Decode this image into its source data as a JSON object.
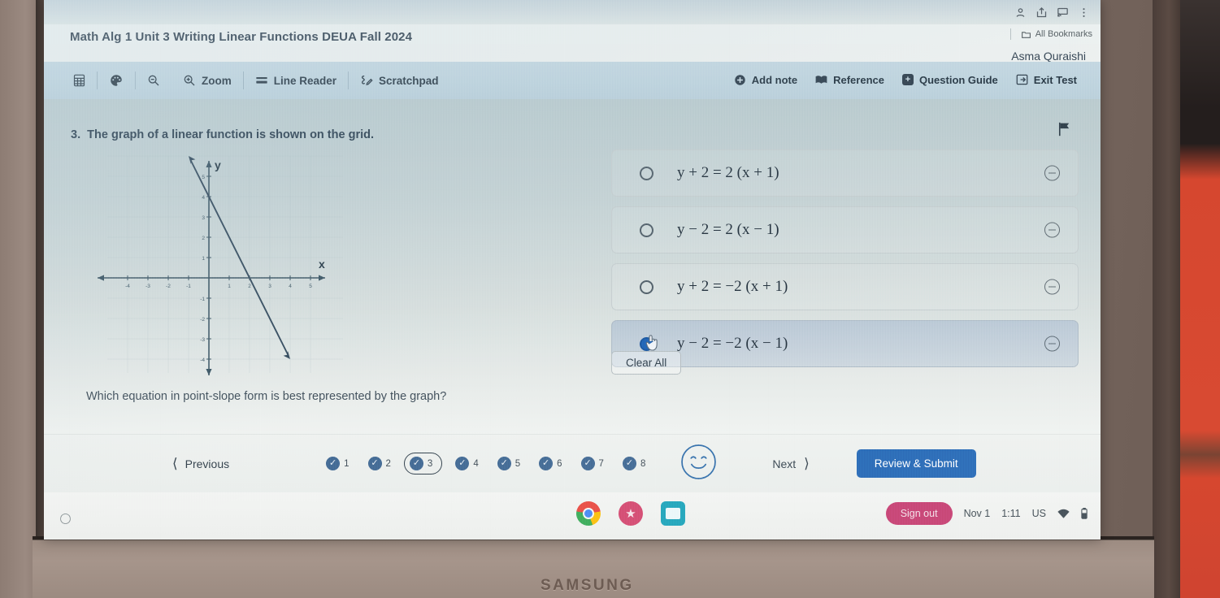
{
  "device": {
    "brand": "SAMSUNG"
  },
  "browser": {
    "all_bookmarks_label": "All Bookmarks",
    "folder_icon": "folder-icon",
    "menu_icon": "kebab-menu-icon",
    "cast_icon": "cast-icon",
    "share_icon": "share-icon",
    "profile_icon": "profile-icon"
  },
  "header": {
    "title": "Math Alg 1 Unit 3 Writing Linear Functions DEUA Fall 2024",
    "student_name": "Asma Quraishi"
  },
  "toolbar": {
    "left_tools": [
      {
        "name": "calculator",
        "icon": "calculator-icon",
        "label": ""
      },
      {
        "name": "color-palette",
        "icon": "palette-icon",
        "label": ""
      },
      {
        "name": "zoom",
        "icon": "zoom-icon",
        "label": "Zoom"
      },
      {
        "name": "line-reader",
        "icon": "line-reader-icon",
        "label": "Line Reader"
      },
      {
        "name": "scratchpad",
        "icon": "scratchpad-icon",
        "label": "Scratchpad"
      }
    ],
    "right_tools": [
      {
        "name": "add-note",
        "icon": "plus-circle-icon",
        "label": "Add note"
      },
      {
        "name": "reference",
        "icon": "book-icon",
        "label": "Reference"
      },
      {
        "name": "question-guide",
        "icon": "guide-icon",
        "label": "Question Guide"
      },
      {
        "name": "exit-test",
        "icon": "exit-icon",
        "label": "Exit Test"
      }
    ]
  },
  "question": {
    "number": "3.",
    "stem": "The graph of a linear function is shown on the grid.",
    "prompt": "Which equation in point-slope form is best represented by the graph?",
    "flag_icon": "flag-icon"
  },
  "chart_data": {
    "type": "line",
    "title": "",
    "xlabel": "x",
    "ylabel": "y",
    "xlim": [
      -5,
      5.6
    ],
    "ylim": [
      -4.8,
      6
    ],
    "xticks": [
      -4,
      -3,
      -2,
      -1,
      1,
      2,
      3,
      4,
      5
    ],
    "yticks": [
      -4,
      -3,
      -2,
      -1,
      1,
      2,
      3,
      4,
      5
    ],
    "grid": true,
    "series": [
      {
        "name": "linear function",
        "equation": "y = -2x + 4",
        "slope": -2,
        "y_intercept": 4,
        "x_intercept": 2,
        "points": [
          [
            -1,
            6
          ],
          [
            0,
            4
          ],
          [
            1,
            2
          ],
          [
            2,
            0
          ],
          [
            3,
            -2
          ],
          [
            4,
            -4
          ]
        ],
        "endpoints_arrows": true,
        "color": "#2e4558"
      }
    ]
  },
  "options": [
    {
      "id": "A",
      "equation": "y + 2 = 2 (x + 1)",
      "selected": false,
      "eliminate_icon": "minus-circle-icon"
    },
    {
      "id": "B",
      "equation": "y − 2 = 2 (x − 1)",
      "selected": false,
      "eliminate_icon": "minus-circle-icon"
    },
    {
      "id": "C",
      "equation": "y + 2 = −2 (x + 1)",
      "selected": false,
      "eliminate_icon": "minus-circle-icon"
    },
    {
      "id": "D",
      "equation": "y − 2 = −2 (x − 1)",
      "selected": true,
      "eliminate_icon": "minus-circle-icon"
    }
  ],
  "clear_all_label": "Clear All",
  "bottom_nav": {
    "previous_label": "Previous",
    "previous_icon": "chevron-left-icon",
    "next_label": "Next",
    "next_icon": "chevron-right-icon",
    "review_submit_label": "Review & Submit",
    "smiley_icon": "smiley-face-icon",
    "questions": [
      {
        "number": "1",
        "answered": true,
        "current": false
      },
      {
        "number": "2",
        "answered": true,
        "current": false
      },
      {
        "number": "3",
        "answered": true,
        "current": true
      },
      {
        "number": "4",
        "answered": true,
        "current": false
      },
      {
        "number": "5",
        "answered": true,
        "current": false
      },
      {
        "number": "6",
        "answered": true,
        "current": false
      },
      {
        "number": "7",
        "answered": true,
        "current": false
      },
      {
        "number": "8",
        "answered": true,
        "current": false
      }
    ]
  },
  "shelf": {
    "launcher_icon": "launcher-circle-icon",
    "apps": [
      {
        "name": "chrome",
        "icon": "chrome-icon"
      },
      {
        "name": "app-red",
        "icon": "red-app-icon"
      },
      {
        "name": "app-teal",
        "icon": "teal-app-icon"
      }
    ],
    "sign_out_label": "Sign out",
    "date": "Nov 1",
    "time": "1:11",
    "locale": "US",
    "wifi_icon": "wifi-icon",
    "battery_icon": "battery-icon"
  },
  "colors": {
    "accent": "#1d62b3",
    "toolbar_bg": "#bdd3de",
    "selected_option": "#aabcd0",
    "sign_out": "#c3376b",
    "graph_line": "#2e4558"
  }
}
